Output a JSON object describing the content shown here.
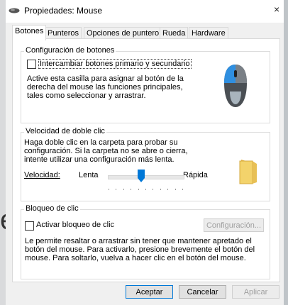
{
  "window": {
    "title": "Propiedades: Mouse",
    "close_glyph": "×"
  },
  "background": {
    "letter": "e"
  },
  "tabs": [
    {
      "label": "Botones",
      "active": true
    },
    {
      "label": "Punteros",
      "active": false
    },
    {
      "label": "Opciones de puntero",
      "active": false
    },
    {
      "label": "Rueda",
      "active": false
    },
    {
      "label": "Hardware",
      "active": false
    }
  ],
  "button_config": {
    "title": "Configuración de botones",
    "checkbox_label": "Intercambiar botones primario y secundario",
    "checkbox_checked": false,
    "description": "Active esta casilla para asignar al botón de la derecha del mouse las funciones principales, tales como seleccionar y arrastrar.",
    "icon": "mouse-icon"
  },
  "double_click": {
    "title": "Velocidad de doble clic",
    "description": "Haga doble clic en la carpeta para probar su configuración. Si la carpeta no se abre o cierra, intente utilizar una configuración más lenta.",
    "speed_label": "Velocidad:",
    "slow_label": "Lenta",
    "fast_label": "Rápida",
    "speed_level": 0.45,
    "icon": "folder-icon"
  },
  "click_lock": {
    "title": "Bloqueo de clic",
    "checkbox_label": "Activar bloqueo de clic",
    "checkbox_checked": false,
    "settings_button": "Configuración...",
    "settings_enabled": false,
    "description": "Le permite resaltar o arrastrar sin tener que mantener apretado el botón del mouse. Para activarlo, presione brevemente el botón del mouse. Para soltarlo, vuelva a hacer clic en el botón del mouse."
  },
  "footer": {
    "ok": "Aceptar",
    "cancel": "Cancelar",
    "apply": "Aplicar"
  },
  "colors": {
    "accent": "#0078d7",
    "mouse_body": "#4a4f54",
    "mouse_button": "#2f8fe0",
    "folder": "#f3d36b"
  }
}
